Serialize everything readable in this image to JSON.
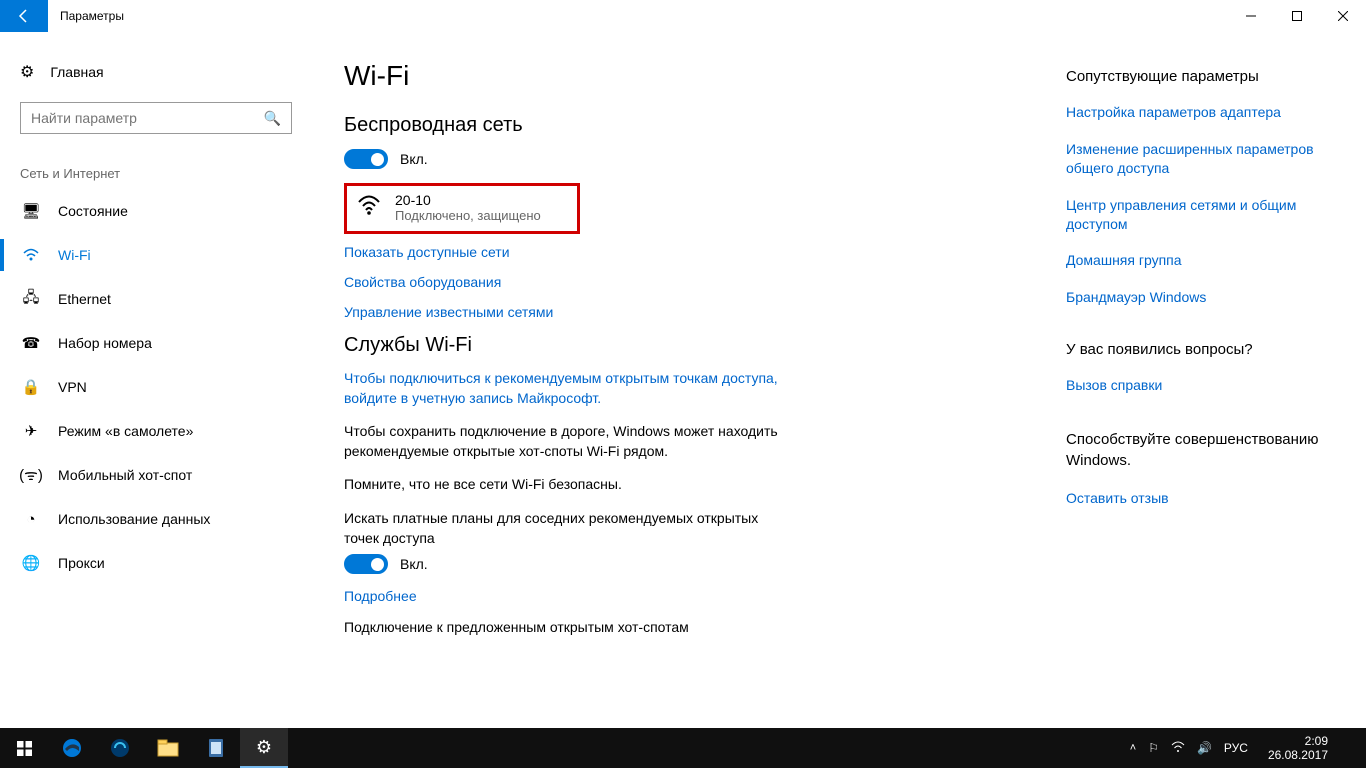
{
  "window": {
    "title": "Параметры"
  },
  "sidebar": {
    "home": "Главная",
    "searchPlaceholder": "Найти параметр",
    "category": "Сеть и Интернет",
    "items": [
      {
        "label": "Состояние"
      },
      {
        "label": "Wi-Fi"
      },
      {
        "label": "Ethernet"
      },
      {
        "label": "Набор номера"
      },
      {
        "label": "VPN"
      },
      {
        "label": "Режим «в самолете»"
      },
      {
        "label": "Мобильный хот-спот"
      },
      {
        "label": "Использование данных"
      },
      {
        "label": "Прокси"
      }
    ]
  },
  "main": {
    "title": "Wi-Fi",
    "wirelessHeading": "Беспроводная сеть",
    "toggleOn": "Вкл.",
    "network": {
      "name": "20-10",
      "status": "Подключено, защищено"
    },
    "links": {
      "showNetworks": "Показать доступные сети",
      "hwProps": "Свойства оборудования",
      "manageKnown": "Управление известными сетями",
      "signIn": "Чтобы подключиться к рекомендуемым открытым точкам доступа, войдите в учетную запись Майкрософт.",
      "more": "Подробнее"
    },
    "servicesHeading": "Службы Wi-Fi",
    "p1": "Чтобы сохранить подключение в дороге, Windows может находить рекомендуемые открытые хот-споты Wi-Fi рядом.",
    "p2": "Помните, что не все сети Wi-Fi безопасны.",
    "p3": "Искать платные планы для соседних рекомендуемых открытых точек доступа",
    "p4": "Подключение к предложенным открытым хот-спотам"
  },
  "related": {
    "heading1": "Сопутствующие параметры",
    "links": [
      "Настройка параметров адаптера",
      "Изменение расширенных параметров общего доступа",
      "Центр управления сетями и общим доступом",
      "Домашняя группа",
      "Брандмауэр Windows"
    ],
    "heading2": "У вас появились вопросы?",
    "help": "Вызов справки",
    "heading3": "Способствуйте совершенствованию Windows.",
    "feedback": "Оставить отзыв"
  },
  "taskbar": {
    "lang": "РУС",
    "time": "2:09",
    "date": "26.08.2017"
  }
}
